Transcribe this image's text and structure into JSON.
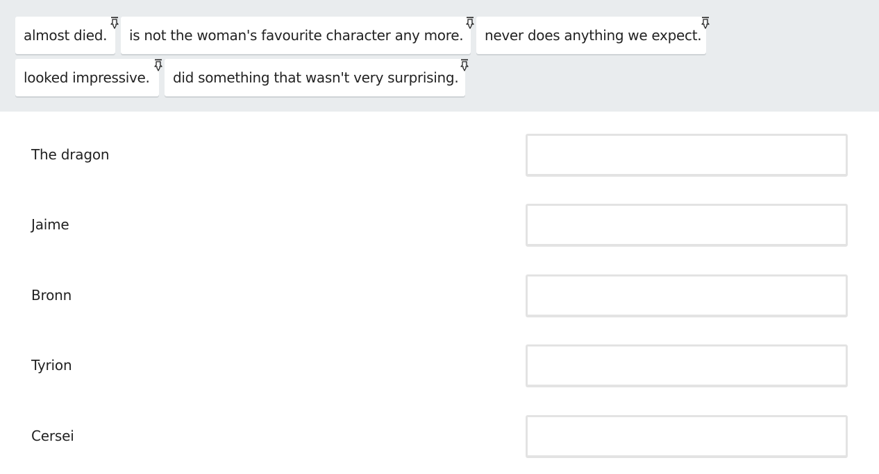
{
  "draggables": [
    {
      "label": "almost died."
    },
    {
      "label": "is not the woman's favourite character any more."
    },
    {
      "label": "never does anything we expect."
    },
    {
      "label": "looked impressive."
    },
    {
      "label": "did something that wasn't very surprising."
    }
  ],
  "targets": [
    {
      "label": "The dragon",
      "value": ""
    },
    {
      "label": "Jaime",
      "value": ""
    },
    {
      "label": "Bronn",
      "value": ""
    },
    {
      "label": "Tyrion",
      "value": ""
    },
    {
      "label": "Cersei",
      "value": ""
    }
  ],
  "icons": {
    "drag_handle": "drag-icon"
  },
  "colors": {
    "pool_background": "#e9ecee",
    "chip_background": "#ffffff",
    "dropzone_border": "#e3e3e3",
    "text": "#222222"
  }
}
